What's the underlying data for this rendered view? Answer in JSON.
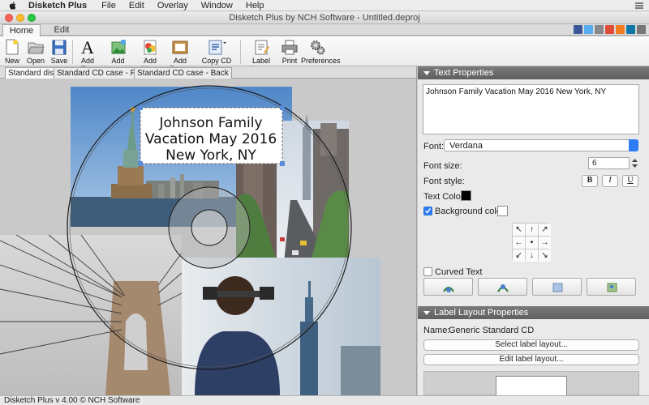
{
  "menubar": {
    "app_name": "Disketch Plus",
    "items": [
      "File",
      "Edit",
      "Overlay",
      "Window",
      "Help"
    ]
  },
  "window": {
    "title": "Disketch Plus by NCH Software - Untitled.deproj"
  },
  "tabs": {
    "home": "Home",
    "edit": "Edit"
  },
  "toolbar": {
    "new": "New",
    "open": "Open",
    "save": "Save",
    "add_text": "Add Text",
    "add_images": "Add Image(s)",
    "add_clipart": "Add Clipart",
    "add_frame": "Add Frame",
    "copy_cd_info": "Copy CD Info",
    "label_layout": "Label Layout",
    "print": "Print",
    "preferences": "Preferences"
  },
  "doc_tabs": {
    "standard_disc": "Standard disc",
    "cd_front": "Standard CD case - Front",
    "cd_back": "Standard CD case - Back"
  },
  "canvas": {
    "text_line1": "Johnson Family",
    "text_line2": "Vacation May 2016",
    "text_line3": "New York, NY"
  },
  "text_properties": {
    "header": "Text Properties",
    "text_value": "Johnson Family Vacation May 2016 New York, NY",
    "font_label": "Font:",
    "font_value": "Verdana",
    "font_size_label": "Font size:",
    "font_size_value": "6",
    "font_style_label": "Font style:",
    "bold": "B",
    "italic": "I",
    "underline": "U",
    "text_color_label": "Text Color:",
    "background_color_label": "Background color:",
    "curved_text_label": "Curved Text",
    "text_color": "#000000",
    "background_color": "#ffffff",
    "background_enabled": true,
    "curved_text_enabled": false
  },
  "label_layout_properties": {
    "header": "Label Layout Properties",
    "name_label": "Name:",
    "name_value": "Generic Standard CD",
    "select_button": "Select label layout...",
    "edit_button": "Edit label layout..."
  },
  "status": {
    "text": "Disketch Plus v 4.00 © NCH Software"
  },
  "colors": {
    "accent": "#2e7cf6",
    "panel_header": "#6a6a6a"
  }
}
